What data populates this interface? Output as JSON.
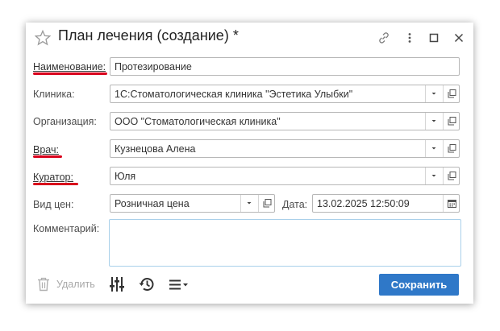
{
  "window": {
    "title": "План лечения (создание) *"
  },
  "fields": {
    "name": {
      "label": "Наименование:",
      "value": "Протезирование"
    },
    "clinic": {
      "label": "Клиника:",
      "value": "1С:Стоматологическая клиника \"Эстетика Улыбки\""
    },
    "organization": {
      "label": "Организация:",
      "value": "ООО \"Стоматологическая клиника\""
    },
    "doctor": {
      "label": "Врач:",
      "value": "Кузнецова Алена"
    },
    "curator": {
      "label": "Куратор:",
      "value": "Юля"
    },
    "price_type": {
      "label": "Вид цен:",
      "value": "Розничная цена"
    },
    "date": {
      "label": "Дата:",
      "value": "13.02.2025 12:50:09"
    },
    "comment": {
      "label": "Комментарий:",
      "value": ""
    }
  },
  "footer": {
    "delete_label": "Удалить",
    "save_label": "Сохранить"
  },
  "colors": {
    "accent": "#2f78c8",
    "required_marker": "#d9001b",
    "focus_border": "#a9d0ea"
  },
  "icons": [
    "star-icon",
    "link-icon",
    "more-icon",
    "maximize-icon",
    "close-icon",
    "dropdown-icon",
    "open-icon",
    "calendar-icon",
    "trash-icon",
    "settings-icon",
    "history-icon",
    "menu-icon"
  ]
}
